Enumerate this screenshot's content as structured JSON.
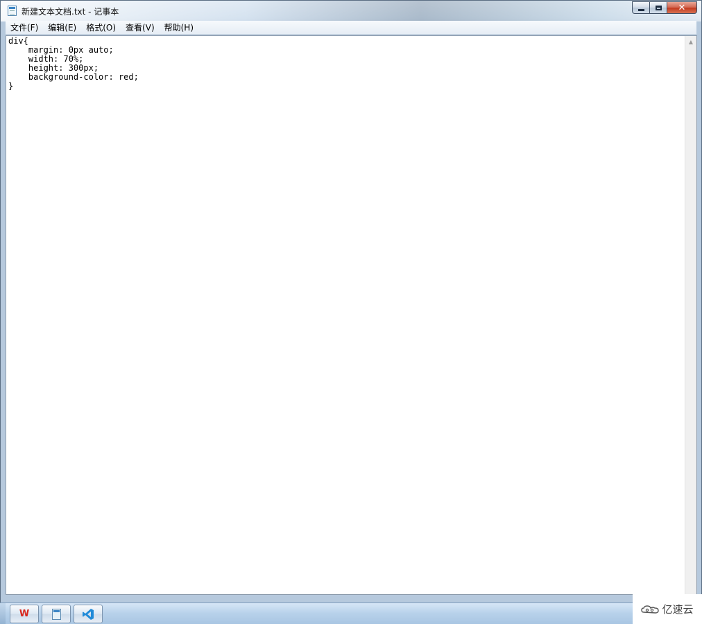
{
  "window": {
    "title": "新建文本文档.txt - 记事本",
    "controls": {
      "minimize": "minimize",
      "maximize": "maximize",
      "close": "✕"
    }
  },
  "menubar": {
    "items": [
      {
        "label": "文件(F)"
      },
      {
        "label": "编辑(E)"
      },
      {
        "label": "格式(O)"
      },
      {
        "label": "查看(V)"
      },
      {
        "label": "帮助(H)"
      }
    ]
  },
  "editor": {
    "content": "div{\n    margin: 0px auto;\n    width: 70%;\n    height: 300px;\n    background-color: red;\n}"
  },
  "taskbar": {
    "apps": [
      {
        "name": "wps-office",
        "icon": "wps-icon",
        "glyph": "W"
      },
      {
        "name": "notepad",
        "icon": "notepad-icon"
      },
      {
        "name": "visual-studio-code",
        "icon": "vscode-icon"
      }
    ]
  },
  "watermark": {
    "text": "亿速云"
  },
  "colors": {
    "vscode_blue": "#1f8ad8",
    "wps_red": "#d8261c"
  }
}
